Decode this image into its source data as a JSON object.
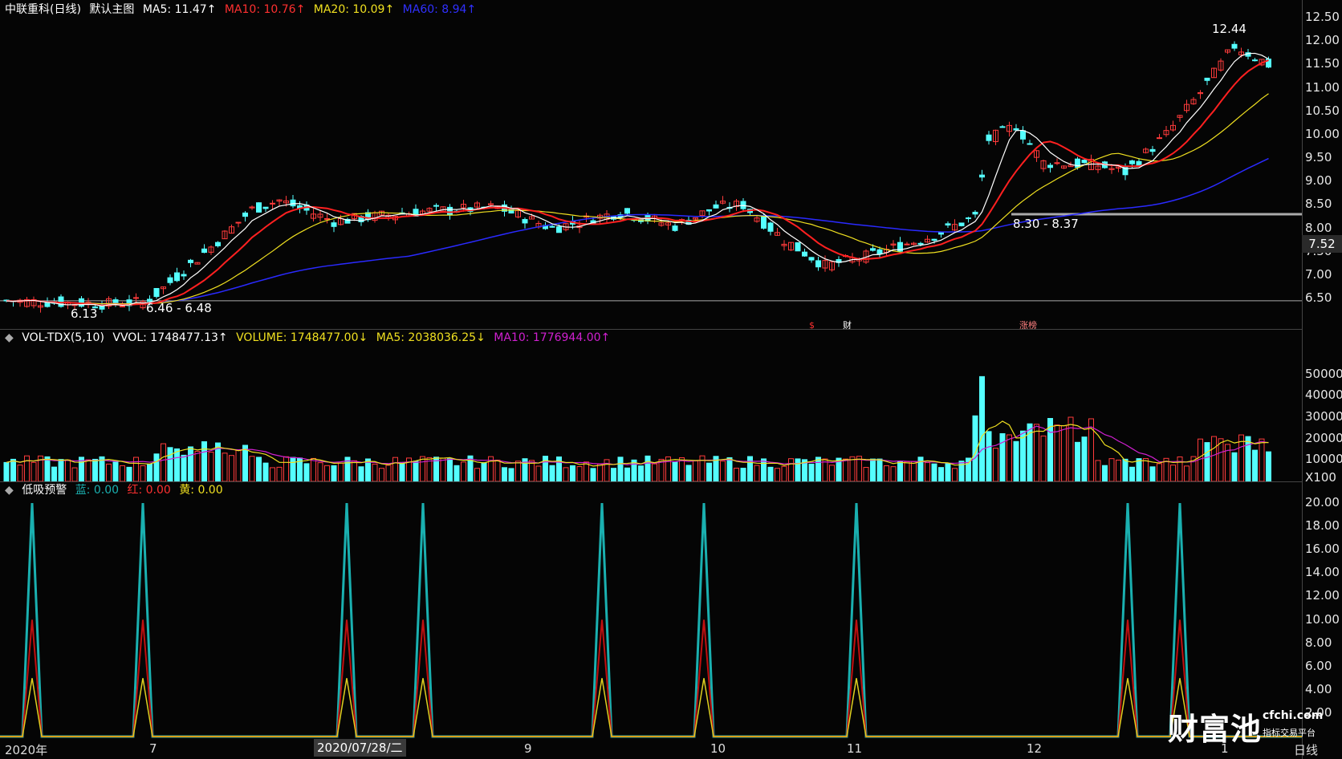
{
  "header_price": {
    "stock_name": "中联重科(日线)",
    "template": "默认主图",
    "ma5": "MA5: 11.47",
    "ma10": "MA10: 10.76",
    "ma20": "MA20: 10.09",
    "ma60": "MA60: 8.94"
  },
  "header_volume": {
    "indicator": "VOL-TDX(5,10)",
    "vvol": "VVOL: 1748477.13",
    "volume": "VOLUME: 1748477.00",
    "ma5": "MA5: 2038036.25",
    "ma10": "MA10: 1776944.00"
  },
  "header_indicator": {
    "name": "低吸预警",
    "blue": "蓝: 0.00",
    "red": "红: 0.00",
    "yellow": "黄: 0.00"
  },
  "colors": {
    "up": "#ff3b3b",
    "down": "#54ffff",
    "ma5": "#ffffff",
    "ma10": "#ff2020",
    "ma20": "#f0e020",
    "ma60": "#2a2aff",
    "vma10": "#d020d0",
    "ind_blue": "#1ab0b0",
    "ind_red": "#c01010",
    "ind_yellow": "#e0d020"
  },
  "price_axis": [
    "12.50",
    "12.00",
    "11.50",
    "11.00",
    "10.50",
    "10.00",
    "9.50",
    "9.00",
    "8.50",
    "8.00",
    "7.50",
    "7.00",
    "6.50"
  ],
  "volume_axis": [
    "50000",
    "40000",
    "30000",
    "20000",
    "10000",
    "X100"
  ],
  "indicator_axis": [
    "20.00",
    "18.00",
    "16.00",
    "14.00",
    "12.00",
    "10.00",
    "8.00",
    "6.00",
    "4.00",
    "2.00"
  ],
  "current_price": "7.52",
  "annotations": {
    "high": "12.44",
    "low": "6.13",
    "range1": "6.46 - 6.48",
    "range2": "8.30 - 8.37",
    "event_s": "$",
    "event_cai": "财",
    "event_zhangbang": "涨榜"
  },
  "date_axis": {
    "labels": [
      "2020年",
      "7",
      "9",
      "10",
      "11",
      "12",
      "1"
    ],
    "cursor_date": "2020/07/28/二",
    "period": "日线"
  },
  "logo": {
    "big": "财富池",
    "site": "cfchi.com",
    "sub": "指标交易平台"
  },
  "chart_data": [
    {
      "type": "candlestick",
      "title": "中联重科(日线)",
      "ylim": [
        6.3,
        12.6
      ],
      "ma_series": [
        {
          "name": "MA5",
          "last": 11.47
        },
        {
          "name": "MA10",
          "last": 10.76
        },
        {
          "name": "MA20",
          "last": 10.09
        },
        {
          "name": "MA60",
          "last": 8.94
        }
      ],
      "annotated_high": 12.44,
      "annotated_low": 6.13
    },
    {
      "type": "bar",
      "title": "VOL-TDX(5,10)",
      "unit": "X100",
      "ylim": [
        0,
        52000
      ],
      "last_volume": 17484.77,
      "ma5_last": 20380.36,
      "ma10_last": 17769.44
    },
    {
      "type": "line",
      "title": "低吸预警",
      "ylim": [
        0,
        20
      ],
      "spike_peaks": {
        "blue": 20,
        "red": 10,
        "yellow": 5
      },
      "last_values": {
        "blue": 0,
        "red": 0,
        "yellow": 0
      }
    }
  ]
}
